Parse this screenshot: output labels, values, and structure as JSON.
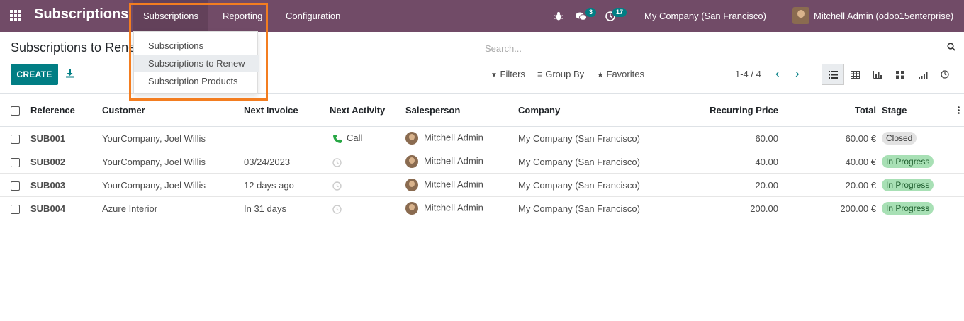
{
  "navbar": {
    "brand": "Subscriptions",
    "menus": [
      "Subscriptions",
      "Reporting",
      "Configuration"
    ],
    "messages_count": "3",
    "activities_count": "17",
    "company": "My Company (San Francisco)",
    "user": "Mitchell Admin (odoo15enterprise)"
  },
  "dropdown": {
    "items": [
      "Subscriptions",
      "Subscriptions to Renew",
      "Subscription Products"
    ],
    "highlighted_item": "Subscriptions to Renew"
  },
  "control_panel": {
    "title": "Subscriptions to Renew",
    "search_placeholder": "Search...",
    "create_label": "CREATE",
    "filters_label": "Filters",
    "groupby_label": "Group By",
    "favorites_label": "Favorites",
    "pager": "1-4 / 4",
    "active_view": "list"
  },
  "table": {
    "columns": [
      "Reference",
      "Customer",
      "Next Invoice",
      "Next Activity",
      "Salesperson",
      "Company",
      "Recurring Price",
      "Total",
      "Stage"
    ],
    "rows": [
      {
        "reference": "SUB001",
        "customer": "YourCompany, Joel Willis",
        "next_invoice": "",
        "next_activity": "Call",
        "salesperson": "Mitchell Admin",
        "company": "My Company (San Francisco)",
        "recurring_price": "60.00",
        "total": "60.00 €",
        "stage": "Closed"
      },
      {
        "reference": "SUB002",
        "customer": "YourCompany, Joel Willis",
        "next_invoice": "03/24/2023",
        "next_activity": "",
        "salesperson": "Mitchell Admin",
        "company": "My Company (San Francisco)",
        "recurring_price": "40.00",
        "total": "40.00 €",
        "stage": "In Progress"
      },
      {
        "reference": "SUB003",
        "customer": "YourCompany, Joel Willis",
        "next_invoice": "12 days ago",
        "next_activity": "",
        "salesperson": "Mitchell Admin",
        "company": "My Company (San Francisco)",
        "recurring_price": "20.00",
        "total": "20.00 €",
        "stage": "In Progress"
      },
      {
        "reference": "SUB004",
        "customer": "Azure Interior",
        "next_invoice": "In 31 days",
        "next_activity": "",
        "salesperson": "Mitchell Admin",
        "company": "My Company (San Francisco)",
        "recurring_price": "200.00",
        "total": "200.00 €",
        "stage": "In Progress"
      }
    ]
  },
  "colors": {
    "navbar": "#714b67",
    "primary": "#017e84",
    "highlight_box": "#f37d20",
    "overdue_text": "#c0392b",
    "stage_in_progress": "#a8e0b5",
    "stage_closed": "#e2e2e2"
  }
}
